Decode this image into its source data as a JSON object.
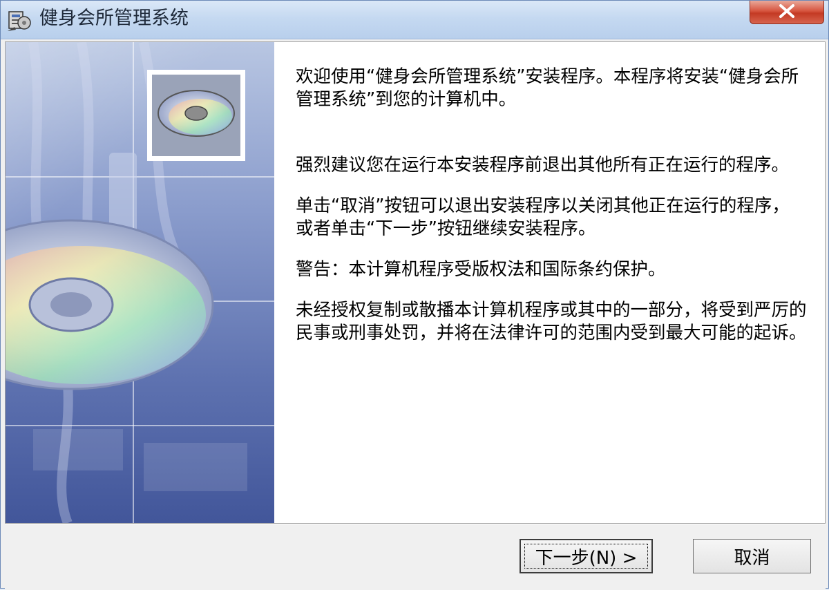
{
  "window": {
    "title": "健身会所管理系统",
    "close_icon": "close-icon"
  },
  "content": {
    "welcome": "欢迎使用“健身会所管理系统”安装程序。本程序将安装“健身会所管理系统”到您的计算机中。",
    "advice": "强烈建议您在运行本安装程序前退出其他所有正在运行的程序。",
    "instructions": "单击“取消”按钮可以退出安装程序以关闭其他正在运行的程序，或者单击“下一步”按钮继续安装程序。",
    "warning": "警告：本计算机程序受版权法和国际条约保护。",
    "notice": "未经授权复制或散播本计算机程序或其中的一部分，将受到严厉的民事或刑事处罚，并将在法律许可的范围内受到最大可能的起诉。"
  },
  "buttons": {
    "next_label": "下一步(N) >",
    "cancel_label": "取消"
  },
  "colors": {
    "titlebar": "#c5d9f1",
    "close_button": "#d7553f",
    "side_panel": "#6a7fbc"
  }
}
